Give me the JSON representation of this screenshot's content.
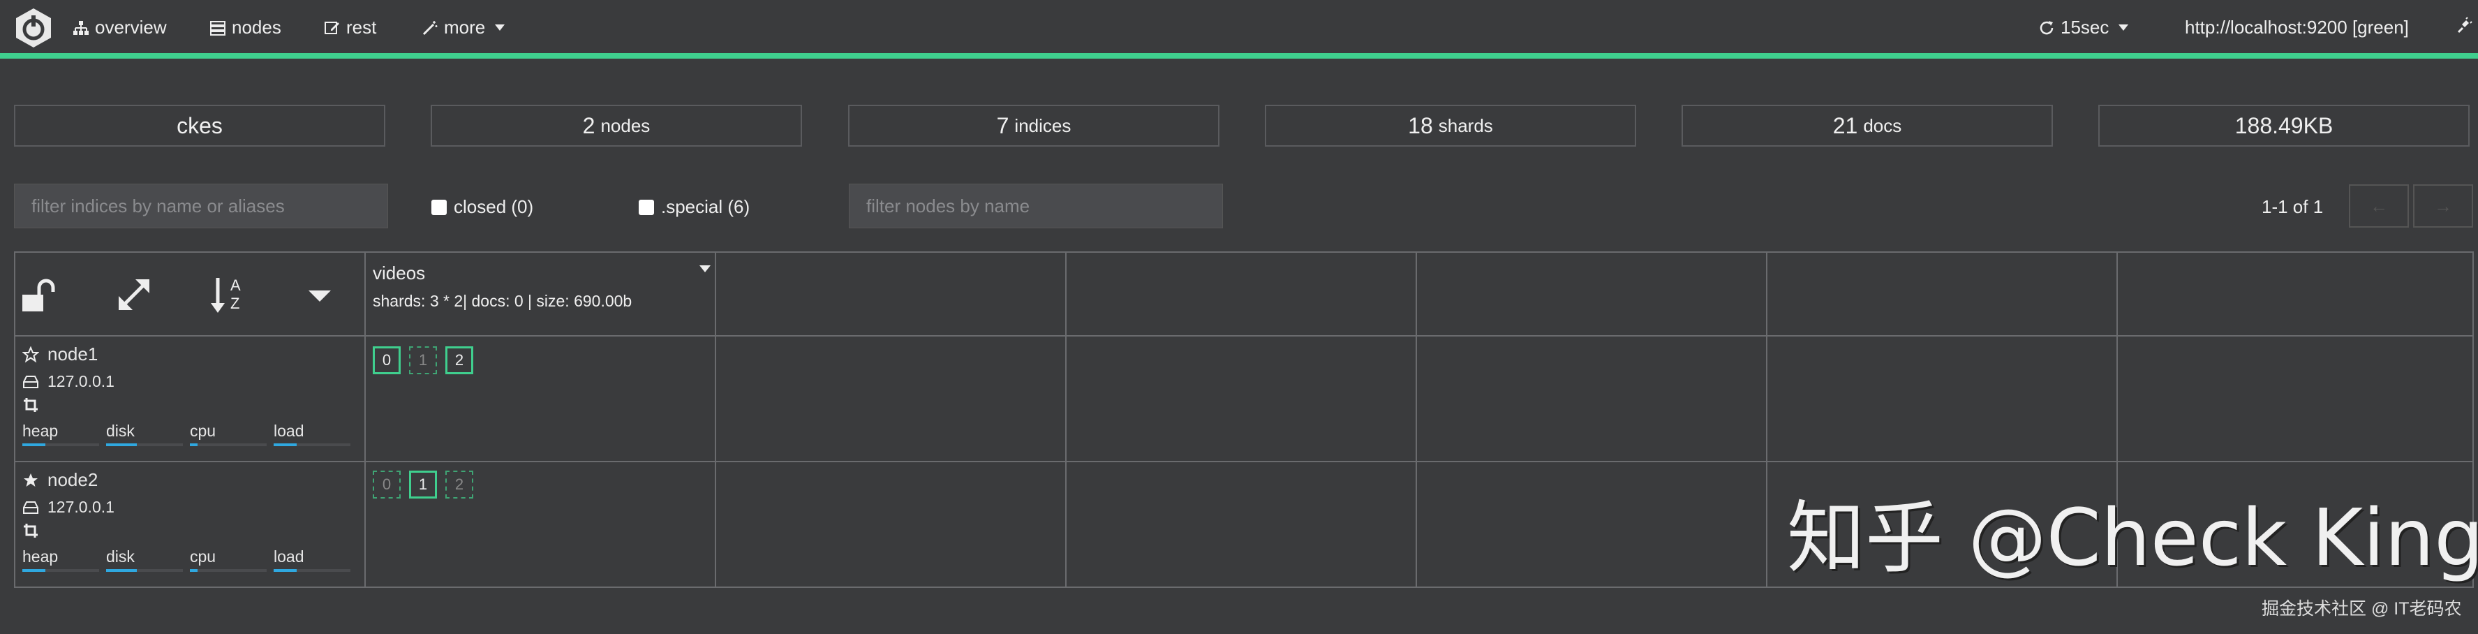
{
  "topbar": {
    "nav": [
      {
        "label": "overview",
        "icon": "sitemap-icon"
      },
      {
        "label": "nodes",
        "icon": "server-icon"
      },
      {
        "label": "rest",
        "icon": "edit-icon"
      },
      {
        "label": "more",
        "icon": "magic-icon"
      }
    ],
    "refresh_label": "15sec",
    "cluster_url": "http://localhost:9200 [green]",
    "accent_color": "#3fcf8e"
  },
  "stats": [
    {
      "value": "ckes",
      "unit": ""
    },
    {
      "value": "2",
      "unit": "nodes"
    },
    {
      "value": "7",
      "unit": "indices"
    },
    {
      "value": "18",
      "unit": "shards"
    },
    {
      "value": "21",
      "unit": "docs"
    },
    {
      "value": "188.49KB",
      "unit": ""
    }
  ],
  "filters": {
    "indices_placeholder": "filter indices by name or aliases",
    "closed_label": "closed (0)",
    "special_label": ".special (6)",
    "nodes_placeholder": "filter nodes by name",
    "pager_text": "1-1 of 1"
  },
  "index": {
    "name": "videos",
    "info": "shards: 3 * 2| docs: 0 | size: 690.00b"
  },
  "nodes": [
    {
      "name": "node1",
      "ip": "127.0.0.1",
      "master": false,
      "metrics": [
        {
          "label": "heap",
          "level": 0.3
        },
        {
          "label": "disk",
          "level": 0.4
        },
        {
          "label": "cpu",
          "level": 0.1
        },
        {
          "label": "load",
          "level": 0.3
        }
      ],
      "shards": [
        {
          "id": "0",
          "type": "primary"
        },
        {
          "id": "1",
          "type": "replica"
        },
        {
          "id": "2",
          "type": "primary"
        }
      ]
    },
    {
      "name": "node2",
      "ip": "127.0.0.1",
      "master": true,
      "metrics": [
        {
          "label": "heap",
          "level": 0.3
        },
        {
          "label": "disk",
          "level": 0.4
        },
        {
          "label": "cpu",
          "level": 0.1
        },
        {
          "label": "load",
          "level": 0.3
        }
      ],
      "shards": [
        {
          "id": "0",
          "type": "replica"
        },
        {
          "id": "1",
          "type": "primary"
        },
        {
          "id": "2",
          "type": "replica"
        }
      ]
    }
  ],
  "watermark": "知乎 @Check King",
  "footer_mark": "掘金技术社区 @ IT老码农"
}
